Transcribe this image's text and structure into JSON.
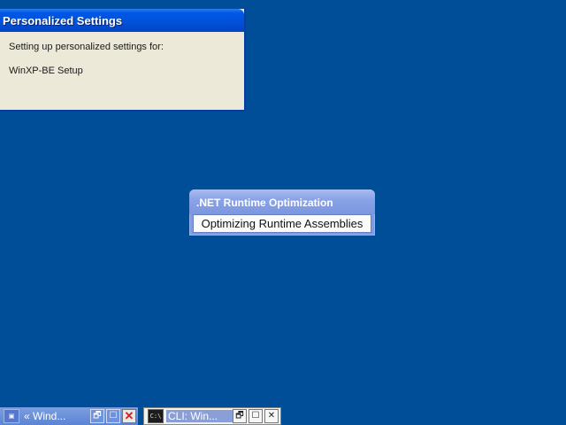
{
  "personalized_settings": {
    "title": "Personalized Settings",
    "line1": "Setting up personalized settings for:",
    "line2": "WinXP-BE Setup"
  },
  "net_optimization": {
    "title": ".NET Runtime Optimization",
    "status": "Optimizing Runtime Assemblies"
  },
  "taskbar": {
    "left_item": {
      "label": "« Wind...",
      "icon": "setup-icon"
    },
    "right_item": {
      "label": "CLI: Win...",
      "icon": "cmd-icon",
      "icon_text": "C:\\"
    },
    "restore_glyph": "🗗",
    "maximize_glyph": "☐",
    "close_glyph": "✕"
  },
  "colors": {
    "desktop": "#004e98",
    "title_bar": "#0058e6",
    "dialog_bg": "#ece9d8"
  }
}
